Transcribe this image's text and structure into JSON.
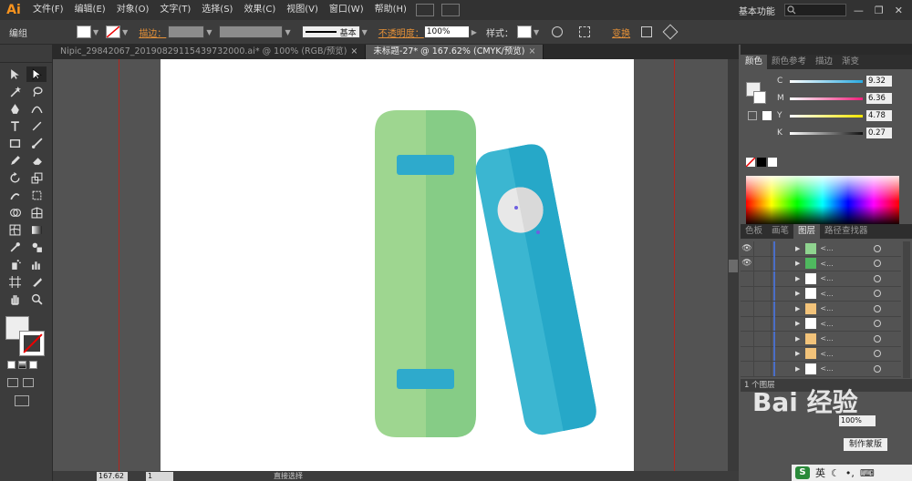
{
  "app": {
    "logo": "Ai"
  },
  "menu": [
    "文件(F)",
    "编辑(E)",
    "对象(O)",
    "文字(T)",
    "选择(S)",
    "效果(C)",
    "视图(V)",
    "窗口(W)",
    "帮助(H)"
  ],
  "menubar_right": {
    "workspace": "基本功能",
    "search_placeholder": ""
  },
  "control": {
    "selection_label": "编组",
    "stroke_label": "描边：",
    "stroke_style": "基本",
    "opacity_label": "不透明度：",
    "opacity_value": "100%",
    "style_label": "样式：",
    "transform_label": "变换"
  },
  "tabs": [
    {
      "label": "Nipic_29842067_20190829115439732000.ai* @ 100% (RGB/预览)",
      "close": "×"
    },
    {
      "label": "未标题-27* @ 167.62% (CMYK/预览)",
      "close": "×"
    }
  ],
  "status": {
    "zoom": "167.62",
    "page": "1",
    "tool": "直接选择"
  },
  "color_panel": {
    "tabs": [
      "颜色",
      "颜色参考",
      "描边",
      "渐变"
    ],
    "sliders": [
      {
        "label": "C",
        "value": "9.32",
        "color": "#29abe2"
      },
      {
        "label": "M",
        "value": "6.36",
        "color": "#ed1e79"
      },
      {
        "label": "Y",
        "value": "4.78",
        "color": "#f2e600"
      },
      {
        "label": "K",
        "value": "0.27",
        "color": "#333333"
      }
    ]
  },
  "layers_panel": {
    "tabs": [
      "色板",
      "画笔",
      "图层",
      "路径查找器"
    ],
    "footer": "1 个图层",
    "rows": [
      {
        "visible": true,
        "thumb": "#8fd38f",
        "name": "<..."
      },
      {
        "visible": true,
        "thumb": "#4fb95f",
        "name": "<..."
      },
      {
        "visible": false,
        "thumb": "#ffffff",
        "name": "<..."
      },
      {
        "visible": false,
        "thumb": "#ffffff",
        "name": "<..."
      },
      {
        "visible": false,
        "thumb": "#f2c37a",
        "name": "<..."
      },
      {
        "visible": false,
        "thumb": "#ffffff",
        "name": "<..."
      },
      {
        "visible": false,
        "thumb": "#f2c37a",
        "name": "<..."
      },
      {
        "visible": false,
        "thumb": "#f2c37a",
        "name": "<..."
      },
      {
        "visible": false,
        "thumb": "#ffffff",
        "name": "<..."
      }
    ]
  },
  "lower_panel": {
    "opacity_value": "100%",
    "make_mask": "制作蒙版"
  },
  "watermark": "Bai 经验",
  "ime": {
    "logo": "S",
    "lang": "英"
  },
  "artwork": {
    "book_green_light": "#9ed690",
    "book_green_dark": "#86cc86",
    "book_blue_light": "#3bb6d1",
    "book_blue_dark": "#26a8c8",
    "label_color": "#2eaacc",
    "circle_color": "#e8e8e8"
  }
}
